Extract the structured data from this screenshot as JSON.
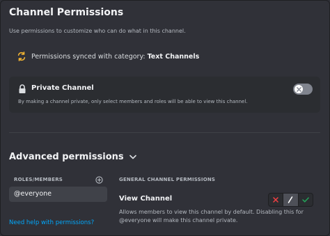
{
  "header": {
    "title": "Channel Permissions",
    "subtitle": "Use permissions to customize who can do what in this channel."
  },
  "sync": {
    "text": "Permissions synced with category:",
    "category": "Text Channels"
  },
  "private_channel": {
    "label": "Private Channel",
    "description": "By making a channel private, only select members and roles will be able to view this channel.",
    "enabled": false
  },
  "advanced": {
    "title": "Advanced permissions"
  },
  "roles": {
    "header": "ROLES/MEMBERS",
    "items": [
      "@everyone"
    ],
    "help_link": "Need help with permissions?"
  },
  "permissions": {
    "section_header": "GENERAL CHANNEL PERMISSIONS",
    "items": [
      {
        "name": "View Channel",
        "description": "Allows members to view this channel by default. Disabling this for @everyone will make this channel private.",
        "state": "neutral"
      }
    ]
  },
  "colors": {
    "deny": "#f23f43",
    "allow": "#23a55a",
    "link": "#00a8fc",
    "sync_icon": "#f0b232"
  }
}
